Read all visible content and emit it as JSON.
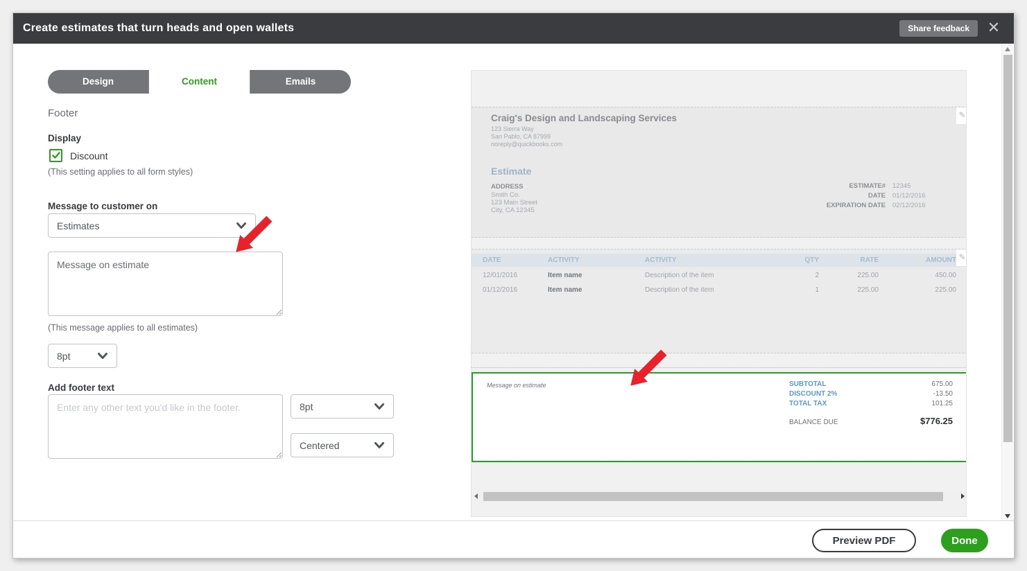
{
  "modal": {
    "title": "Create estimates that turn heads and open wallets",
    "share_feedback": "Share feedback",
    "close_icon": "✕"
  },
  "tabs": {
    "design": "Design",
    "content": "Content",
    "emails": "Emails",
    "active_tab": "Content"
  },
  "settings": {
    "section_title": "Footer",
    "display": {
      "label": "Display",
      "checkbox_label": "Discount",
      "checkbox_checked": true,
      "note": "(This setting applies to all form styles)"
    },
    "message": {
      "label": "Message to customer on",
      "dropdown_value": "Estimates",
      "text": "Message on estimate",
      "note": "(This message applies to all estimates)",
      "font_size": "8pt"
    },
    "footer_text": {
      "label": "Add footer text",
      "placeholder": "Enter any other text you'd like in the footer.",
      "font_size": "8pt",
      "alignment": "Centered"
    }
  },
  "preview": {
    "company": {
      "name": "Craig's Design and Landscaping Services",
      "address1": "123 Sierra Way",
      "address2": "San Pablo, CA 87999",
      "email": "noreply@quickbooks.com"
    },
    "doc_title": "Estimate",
    "billing": {
      "label": "ADDRESS",
      "line1": "Smith Co.",
      "line2": "123 Main Street",
      "line3": "City, CA 12345"
    },
    "meta": {
      "rows": [
        {
          "label": "ESTIMATE#",
          "value": "12345"
        },
        {
          "label": "DATE",
          "value": "01/12/2016"
        },
        {
          "label": "EXPIRATION DATE",
          "value": "02/12/2016"
        }
      ]
    },
    "table": {
      "headers": [
        "DATE",
        "ACTIVITY",
        "ACTIVITY",
        "QTY",
        "RATE",
        "AMOUNT"
      ],
      "rows": [
        [
          "12/01/2016",
          "Item name",
          "Description of the item",
          "2",
          "225.00",
          "450.00"
        ],
        [
          "01/12/2016",
          "Item name",
          "Description of the item",
          "1",
          "225.00",
          "225.00"
        ]
      ]
    },
    "footer": {
      "message": "Message on estimate",
      "totals": [
        {
          "label": "SUBTOTAL",
          "value": "675.00"
        },
        {
          "label": "DISCOUNT 2%",
          "value": "-13.50"
        },
        {
          "label": "TOTAL TAX",
          "value": "101.25"
        }
      ],
      "balance": {
        "label": "BALANCE DUE",
        "value": "$776.25"
      }
    }
  },
  "actions": {
    "preview_pdf": "Preview PDF",
    "done": "Done"
  },
  "icons": {
    "close": "close-icon",
    "chevron": "chevron-down-icon",
    "check": "checkmark-icon",
    "pencil": "edit-pencil-icon",
    "red_arrow": "red-annotation-arrow"
  },
  "colors": {
    "accent_green": "#2ca01c",
    "header_dark": "#3a3c3f",
    "arrow_red": "#e8212a",
    "totals_blue": "#5b9bd5",
    "table_header_blue": "#a3bcd0"
  }
}
